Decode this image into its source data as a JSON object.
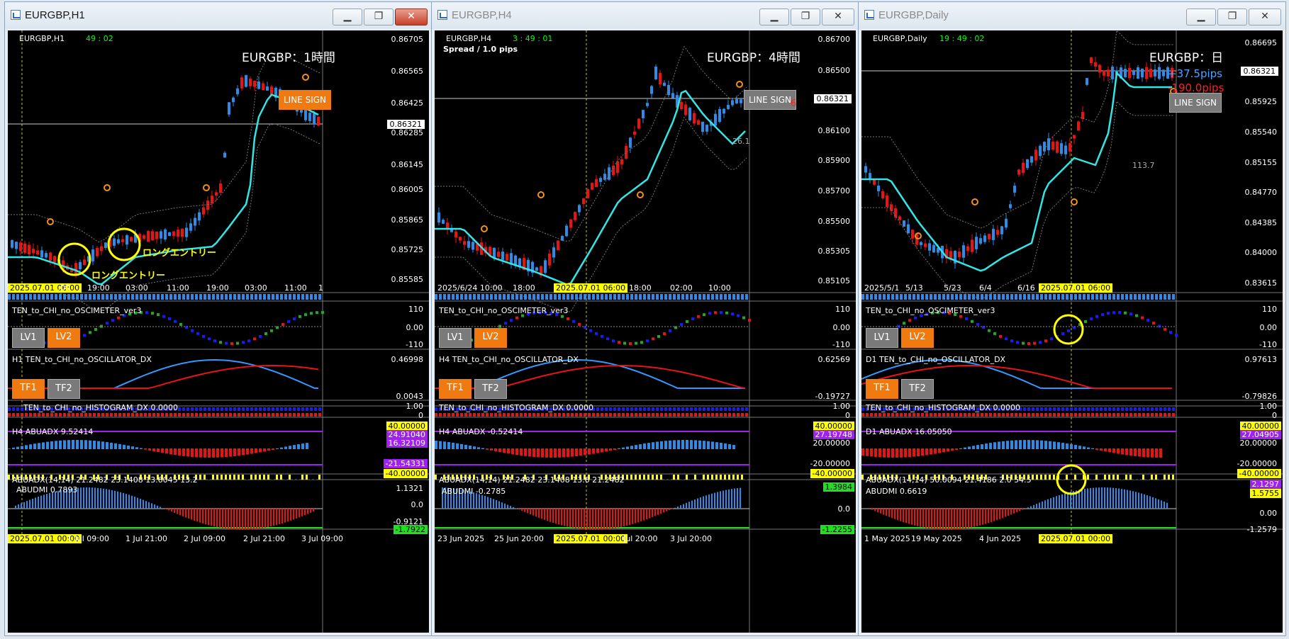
{
  "colors": {
    "bull": "#2e8ce6",
    "bear": "#e81414",
    "ema": "#33e6e6",
    "grid": "#3a3a3a",
    "accent": "#f07a10",
    "marker": "#ffff00"
  },
  "windows": [
    {
      "title": "EURGBP,H1",
      "symbol": "EURGBP,H1",
      "timer": "49 : 02",
      "spread": "",
      "big_title": "EURGBP：1時間",
      "pips_plus": "",
      "pips_minus": "",
      "sign_label": "LINE SIGN",
      "current_price": "0.86321",
      "side_value": "",
      "side_mark": "",
      "price_ticks": [
        "0.86705",
        "0.86565",
        "0.86425",
        "0.86285",
        "0.86145",
        "0.86005",
        "0.85865",
        "0.85725",
        "0.85585"
      ],
      "time_ticks": [
        "2025.07.01 06:00",
        ":00",
        "19:00",
        "03:00",
        "11:00",
        "19:00",
        "03:00",
        "11:00",
        "1"
      ],
      "osc_name": "TEN_to_CHI_no_OSCIMETER_ver3",
      "osc_levels": [
        "110",
        "0.00",
        "-110"
      ],
      "lv1": "LV1",
      "lv2": "LV2",
      "osc_dx_name": "H1 TEN_to_CHI_no_OSCILLATOR_DX",
      "osc_dx_hi": "0.46998",
      "osc_dx_lo": "0.0043",
      "tf1": "TF1",
      "tf2": "TF2",
      "hist_name": "TEN_to_CHI_no_HISTOGRAM_DX 0.0000",
      "hist_levels": [
        "1.00",
        "0.0",
        "0"
      ],
      "abuadx_name": "H4 ABUADX 9.52414",
      "abuadx_boxes": [
        "40.00000",
        "24.91040",
        "16.32109",
        "-21.54331",
        "-40.00000"
      ],
      "abuadx_sub": "ABUADX(14,14) 21.2482 23.1408 13.6045 13.2",
      "abudmi_name": "ABUDMI 0.7893",
      "abudmi_vals": [
        "1.1321",
        "0.0",
        "-0.9121",
        "-1.7922"
      ],
      "bottom_ticks": [
        "2025.07.01 00:00",
        "1 Jul 09:00",
        "1 Jul 21:00",
        "2 Jul 09:00",
        "2 Jul 21:00",
        "3 Jul 09:00"
      ],
      "annotations": [
        "ロングエントリー",
        "ロングエントリー"
      ]
    },
    {
      "title": "EURGBP,H4",
      "symbol": "EURGBP,H4",
      "timer": "3 : 49 : 01",
      "spread": "Spread / 1.0 pips",
      "big_title": "EURGBP：4時間",
      "pips_plus": "",
      "pips_minus": "",
      "sign_label": "LINE SIGN",
      "current_price": "0.86321",
      "side_value": "26.1",
      "side_mark": "6",
      "price_ticks": [
        "0.86700",
        "0.86500",
        "0.86321",
        "0.86100",
        "0.85900",
        "0.85700",
        "0.85500",
        "0.85305",
        "0.85105"
      ],
      "time_ticks": [
        "2025/6/24 10:00",
        "18:00",
        "2025.07.01 06:00",
        "18:00",
        "02:00",
        "10:00"
      ],
      "osc_name": "TEN_to_CHI_no_OSCIMETER_ver3",
      "osc_levels": [
        "110",
        "0.00",
        "-110"
      ],
      "lv1": "LV1",
      "lv2": "LV2",
      "osc_dx_name": "H4 TEN_to_CHI_no_OSCILLATOR_DX",
      "osc_dx_hi": "0.62569",
      "osc_dx_lo": "-0.19727",
      "tf1": "TF1",
      "tf2": "TF2",
      "hist_name": "TEN_to_CHI_no_HISTOGRAM_DX 0.0000",
      "hist_levels": [
        "1.00",
        "0.0",
        "0"
      ],
      "abuadx_name": "H4 ABUADX -0.52414",
      "abuadx_boxes": [
        "40.00000",
        "27.19748",
        "20.00000",
        "-20.00000",
        "-40.00000"
      ],
      "abuadx_sub": "ABUADX(14,14) 21.2482 23.1408 13.6 21.2482",
      "abudmi_name": "ABUDMI -0.2785",
      "abudmi_vals": [
        "1.3984",
        "0.0",
        "",
        "-1.2255"
      ],
      "bottom_ticks": [
        "23 Jun 2025",
        "25 Jun 20:00",
        "2025.07.01 00:00",
        "Jul 20:00",
        "3 Jul 20:00"
      ],
      "annotations": []
    },
    {
      "title": "EURGBP,Daily",
      "symbol": "EURGBP,Daily",
      "timer": "19 : 49 : 02",
      "spread": "",
      "big_title": "EURGBP：日",
      "pips_plus": "+37.5pips",
      "pips_minus": "-190.0pips",
      "sign_label": "LINE SIGN",
      "current_price": "0.86321",
      "side_value": "113.7",
      "side_mark": "",
      "price_ticks": [
        "0.86695",
        "0.86321",
        "0.85925",
        "0.85540",
        "0.85155",
        "0.84770",
        "0.84385",
        "0.84000",
        "0.83615"
      ],
      "time_ticks": [
        "2025/5/1",
        "5/13",
        "5/23",
        "6/4",
        "6/16",
        "2025.07.01 06:00"
      ],
      "osc_name": "TEN_to_CHI_no_OSCIMETER_ver3",
      "osc_levels": [
        "110",
        "0.00",
        "-110"
      ],
      "lv1": "LV1",
      "lv2": "LV2",
      "osc_dx_name": "D1 TEN_to_CHI_no_OSCILLATOR_DX",
      "osc_dx_hi": "0.97613",
      "osc_dx_lo": "-0.79826",
      "tf1": "TF1",
      "tf2": "TF2",
      "hist_name": "TEN_to_CHI_no_HISTOGRAM_DX 0.0000",
      "hist_levels": [
        "1.00",
        "0.0",
        "0"
      ],
      "abuadx_name": "D1 ABUADX 16.05050",
      "abuadx_boxes": [
        "40.00000",
        "27.04905",
        "20.00000",
        "-20.00000",
        "-40.00000"
      ],
      "abuadx_sub": "ABUADX(14,14) 50.0094 21.4186 2.0 54.5",
      "abudmi_name": "ABUDMI 0.6619",
      "abudmi_vals": [
        "2.1297",
        "1.5755",
        "0.00",
        "-1.2579"
      ],
      "bottom_ticks": [
        "1 May 2025",
        "19 May 2025",
        "4 Jun 2025",
        "2025.07.01 00:00"
      ],
      "annotations": []
    }
  ]
}
